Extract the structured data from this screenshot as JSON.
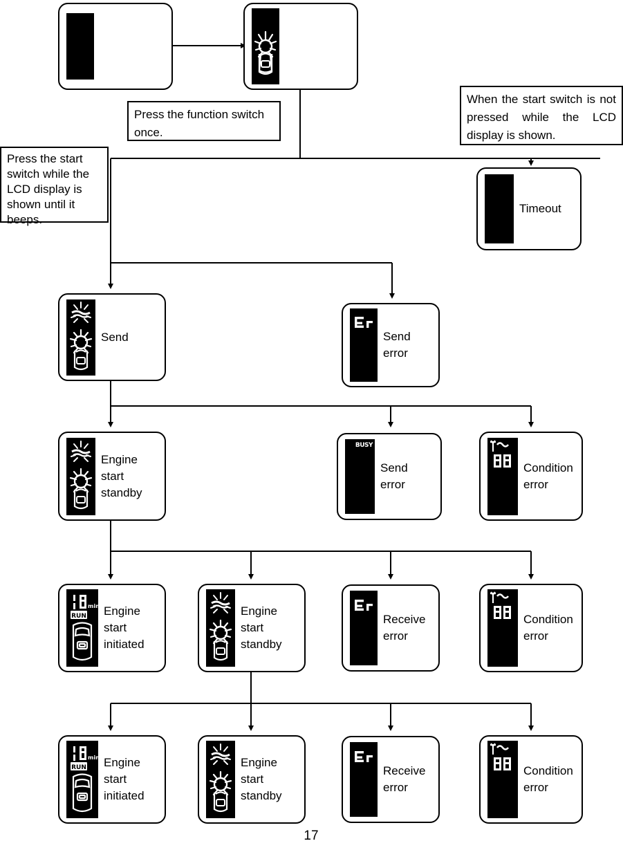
{
  "page": {
    "number": "17"
  },
  "notes": [
    {
      "id": "note-function-switch",
      "text": "Press the function switch once."
    },
    {
      "id": "note-start-switch",
      "text": "Press the start switch while the LCD display is shown until it beeps."
    },
    {
      "id": "note-timeout-condition",
      "text": "When the start switch is not pressed while the LCD display is shown."
    }
  ],
  "nodes": {
    "idle": {
      "label": "",
      "lcd": "blank"
    },
    "lcd_shown": {
      "label": "",
      "lcd": "car-burst"
    },
    "timeout": {
      "label": "Timeout",
      "lcd": "blank"
    },
    "send": {
      "label": "Send",
      "lcd": "signal-car-burst"
    },
    "send_error_er": {
      "label": "Send\nerror",
      "lcd": "er"
    },
    "engine_start_standby_1": {
      "label": "Engine\nstart\nstandby",
      "lcd": "signal-car-burst"
    },
    "send_error_busy": {
      "label": "Send\nerror",
      "lcd": "busy"
    },
    "condition_error_1": {
      "label": "Condition\nerror",
      "lcd": "antenna-88"
    },
    "engine_start_initiated_1": {
      "label": "Engine\nstart\ninitiated",
      "lcd": "run-10min-car"
    },
    "engine_start_standby_2": {
      "label": "Engine\nstart\nstandby",
      "lcd": "signal-car-burst"
    },
    "receive_error_1": {
      "label": "Receive\nerror",
      "lcd": "er"
    },
    "condition_error_2": {
      "label": "Condition\nerror",
      "lcd": "antenna-88"
    },
    "engine_start_initiated_2": {
      "label": "Engine\nstart\ninitiated",
      "lcd": "run-10min-car"
    },
    "engine_start_standby_3": {
      "label": "Engine\nstart\nstandby",
      "lcd": "signal-car-burst"
    },
    "receive_error_2": {
      "label": "Receive\nerror",
      "lcd": "er"
    },
    "condition_error_3": {
      "label": "Condition\nerror",
      "lcd": "antenna-88"
    }
  },
  "lcd_text": {
    "er": "Er",
    "busy": "BUSY",
    "digits88": "88",
    "run": "RUN",
    "minutes": "10",
    "min_unit": "min"
  },
  "colors": {
    "ink": "#000000",
    "paper": "#ffffff",
    "lcd_background": "#000000",
    "lcd_foreground": "#ffffff"
  }
}
